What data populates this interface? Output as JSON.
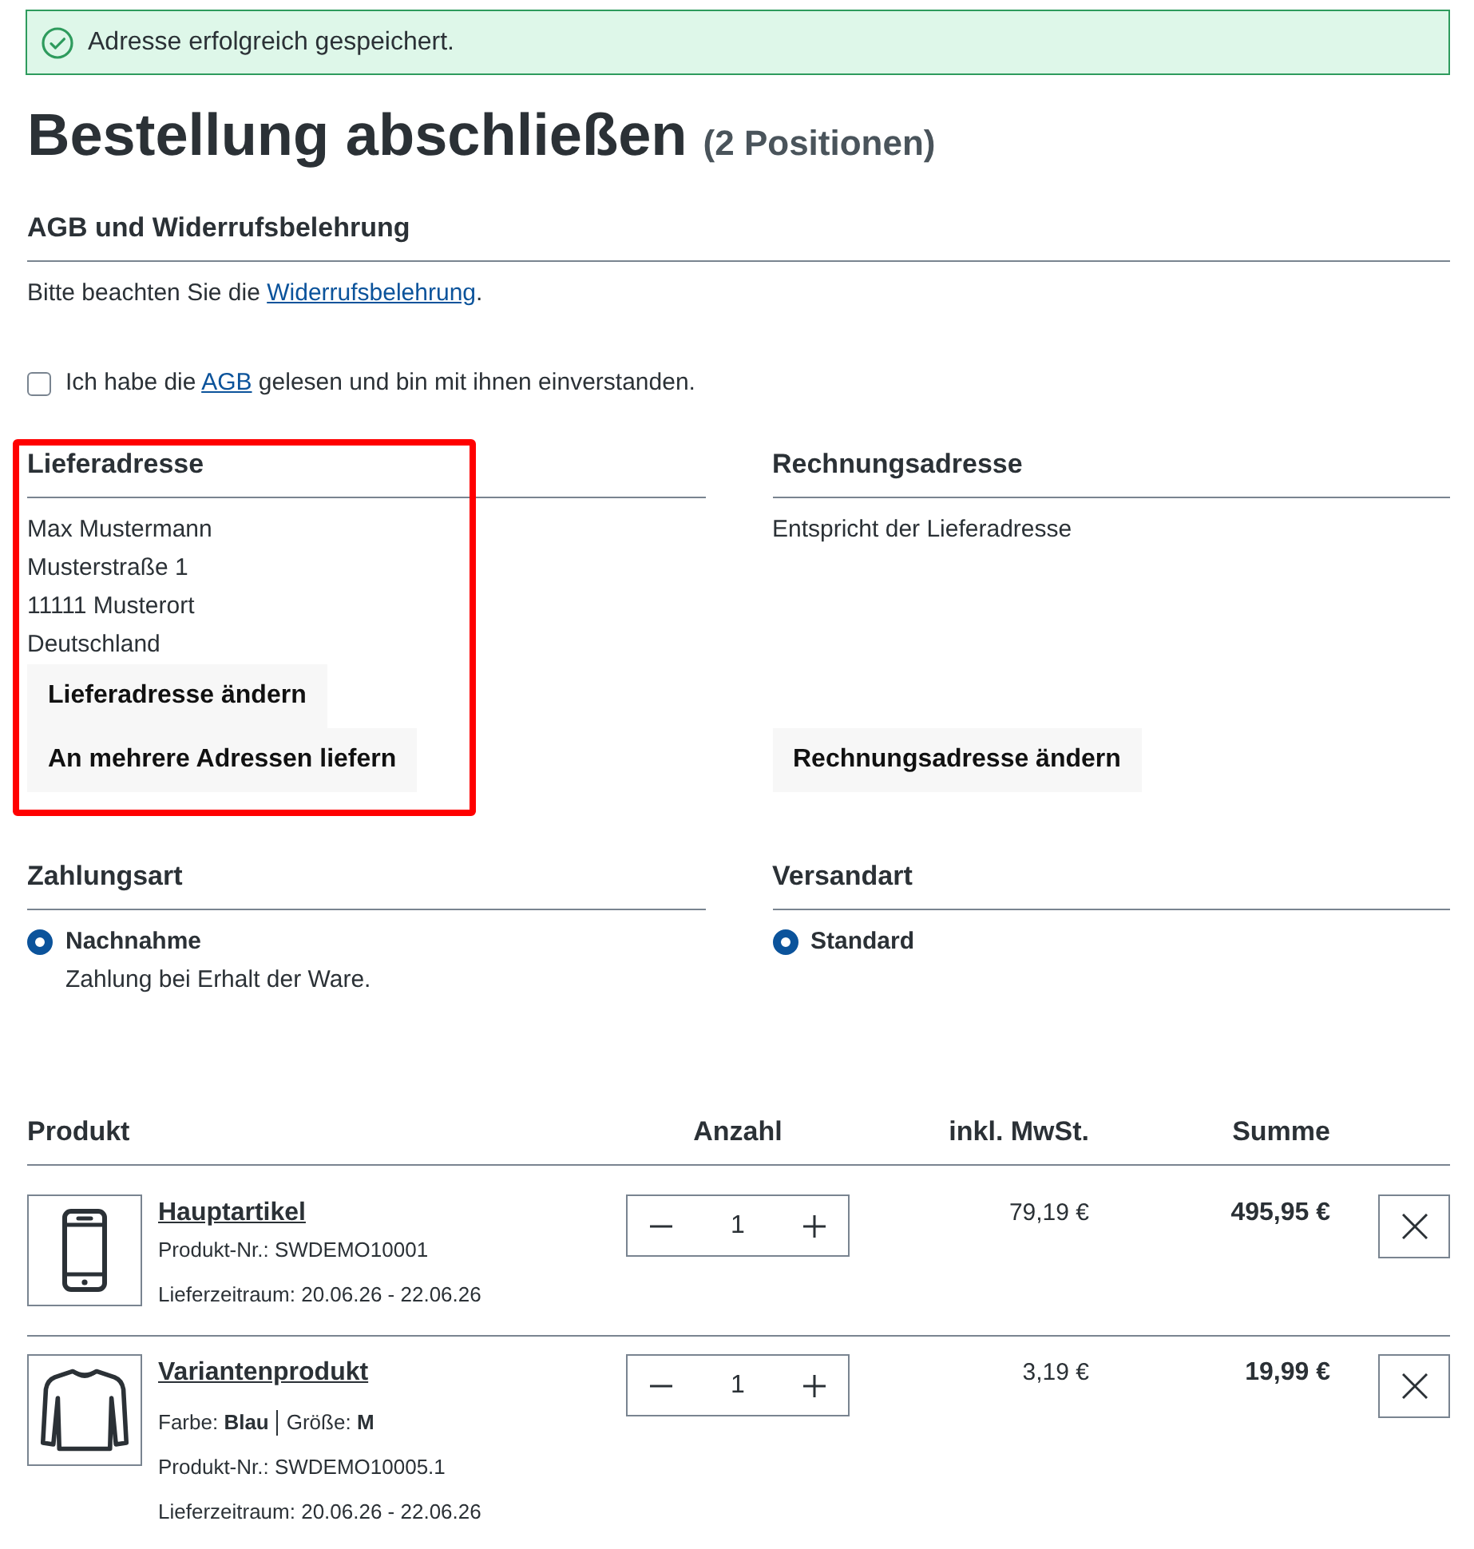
{
  "alert": {
    "kind": "success",
    "message": "Adresse erfolgreich gespeichert."
  },
  "page": {
    "title": "Bestellung abschließen",
    "subtitle": "(2 Positionen)"
  },
  "terms": {
    "heading": "AGB und Widerrufsbelehrung",
    "notice": {
      "before": "Bitte beachten Sie die ",
      "link": "Widerrufsbelehrung",
      "after": "."
    },
    "consent": {
      "checked": false,
      "before": "Ich habe die ",
      "link": "AGB",
      "after": " gelesen und bin mit ihnen einverstanden."
    }
  },
  "addresses": [
    {
      "heading": "Lieferadresse",
      "highlighted": true,
      "lines": [
        "Max Mustermann",
        "Musterstraße 1",
        "11111 Musterort",
        "Deutschland"
      ],
      "buttons": [
        "Lieferadresse ändern",
        "An mehrere Adressen liefern"
      ]
    },
    {
      "heading": "Rechnungsadresse",
      "highlighted": false,
      "lines": [
        "Entspricht der Lieferadresse"
      ],
      "buttons": [
        "Rechnungsadresse ändern"
      ]
    }
  ],
  "options": [
    {
      "heading": "Zahlungsart",
      "methods": [
        {
          "name": "Nachnahme",
          "description": "Zahlung bei Erhalt der Ware.",
          "selected": true
        }
      ]
    },
    {
      "heading": "Versandart",
      "methods": [
        {
          "name": "Standard",
          "selected": true
        }
      ]
    }
  ],
  "cart": {
    "columns": [
      "Produkt",
      "Anzahl",
      "inkl. MwSt.",
      "Summe"
    ],
    "items": [
      {
        "kind": "phone",
        "name": "Hauptartikel",
        "product_number": "Produkt-Nr.: SWDEMO10001",
        "delivery": "Lieferzeitraum: 20.06.26 - 22.06.26",
        "quantity": "1",
        "unit_price": "79,19 €",
        "total": "495,95 €"
      },
      {
        "kind": "shirt",
        "name": "Variantenprodukt",
        "variants": [
          "Farbe: **Blau**",
          "Größe: **M**"
        ],
        "product_number": "Produkt-Nr.: SWDEMO10005.1",
        "delivery": "Lieferzeitraum: 20.06.26 - 22.06.26",
        "quantity": "1",
        "unit_price": "3,19 €",
        "total": "19,99 €"
      }
    ]
  }
}
